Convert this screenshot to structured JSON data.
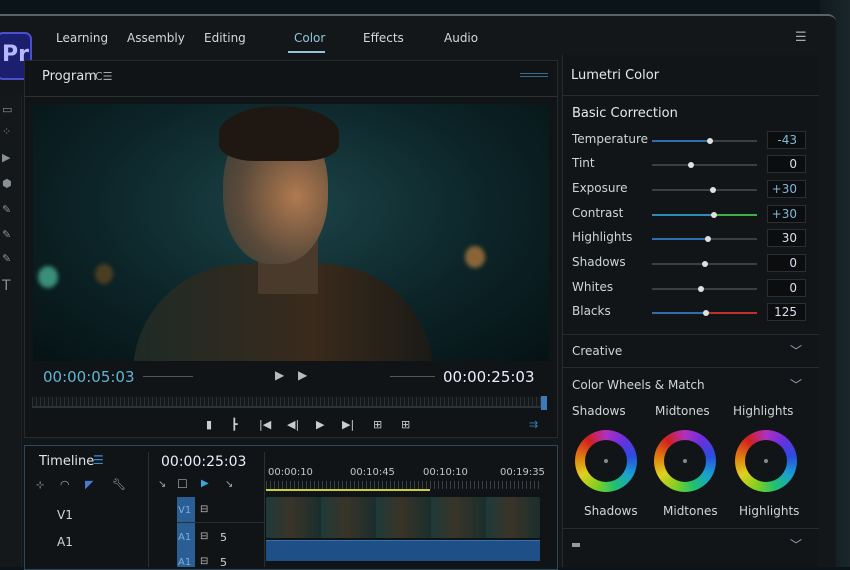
{
  "app": {
    "logo": "Pr"
  },
  "workspaces": [
    {
      "label": "Learning"
    },
    {
      "label": "Assembly"
    },
    {
      "label": "Editing"
    },
    {
      "label": "Color"
    },
    {
      "label": "Effects"
    },
    {
      "label": "Audio"
    }
  ],
  "program": {
    "title": "Program",
    "title_icon": "C☰",
    "current_time": "00:00:05:03",
    "duration": "00:00:25:03"
  },
  "timeline": {
    "title": "Timeline",
    "timecode": "00:00:25:03",
    "ruler": [
      "00:00:10",
      "00:10:45",
      "00:10:10",
      "00:19:35"
    ],
    "tracks": [
      {
        "label": "V1"
      },
      {
        "label": "A1"
      }
    ],
    "targets": [
      {
        "label": "V1",
        "extra": ""
      },
      {
        "label": "A1",
        "extra": "5"
      },
      {
        "label": "A1",
        "extra": "5"
      }
    ],
    "playhead_progress": 0.6
  },
  "lumetri": {
    "title": "Lumetri Color",
    "basic": "Basic Correction",
    "controls": [
      {
        "label": "Temperature",
        "value": "-43",
        "pos": 0.55,
        "left": "#2e6fb0",
        "right": ""
      },
      {
        "label": "Tint",
        "value": "0",
        "pos": 0.37,
        "left": "",
        "right": ""
      },
      {
        "label": "Exposure",
        "value": "+30",
        "pos": 0.58,
        "left": "",
        "right": ""
      },
      {
        "label": "Contrast",
        "value": "+30",
        "pos": 0.59,
        "left": "#2e8ab8",
        "right": "#3cb043"
      },
      {
        "label": "Highlights",
        "value": "30",
        "pos": 0.53,
        "left": "#2e6fb0",
        "right": ""
      },
      {
        "label": "Shadows",
        "value": "0",
        "pos": 0.5,
        "left": "",
        "right": ""
      },
      {
        "label": "Whites",
        "value": "0",
        "pos": 0.47,
        "left": "",
        "right": ""
      },
      {
        "label": "Blacks",
        "value": "125",
        "pos": 0.51,
        "left": "#2e6fb0",
        "right": "#c0302a"
      }
    ],
    "creative": "Creative",
    "wheels": "Color Wheels & Match",
    "wheel_labels": [
      "Shadows",
      "Midtones",
      "Highlights"
    ]
  }
}
